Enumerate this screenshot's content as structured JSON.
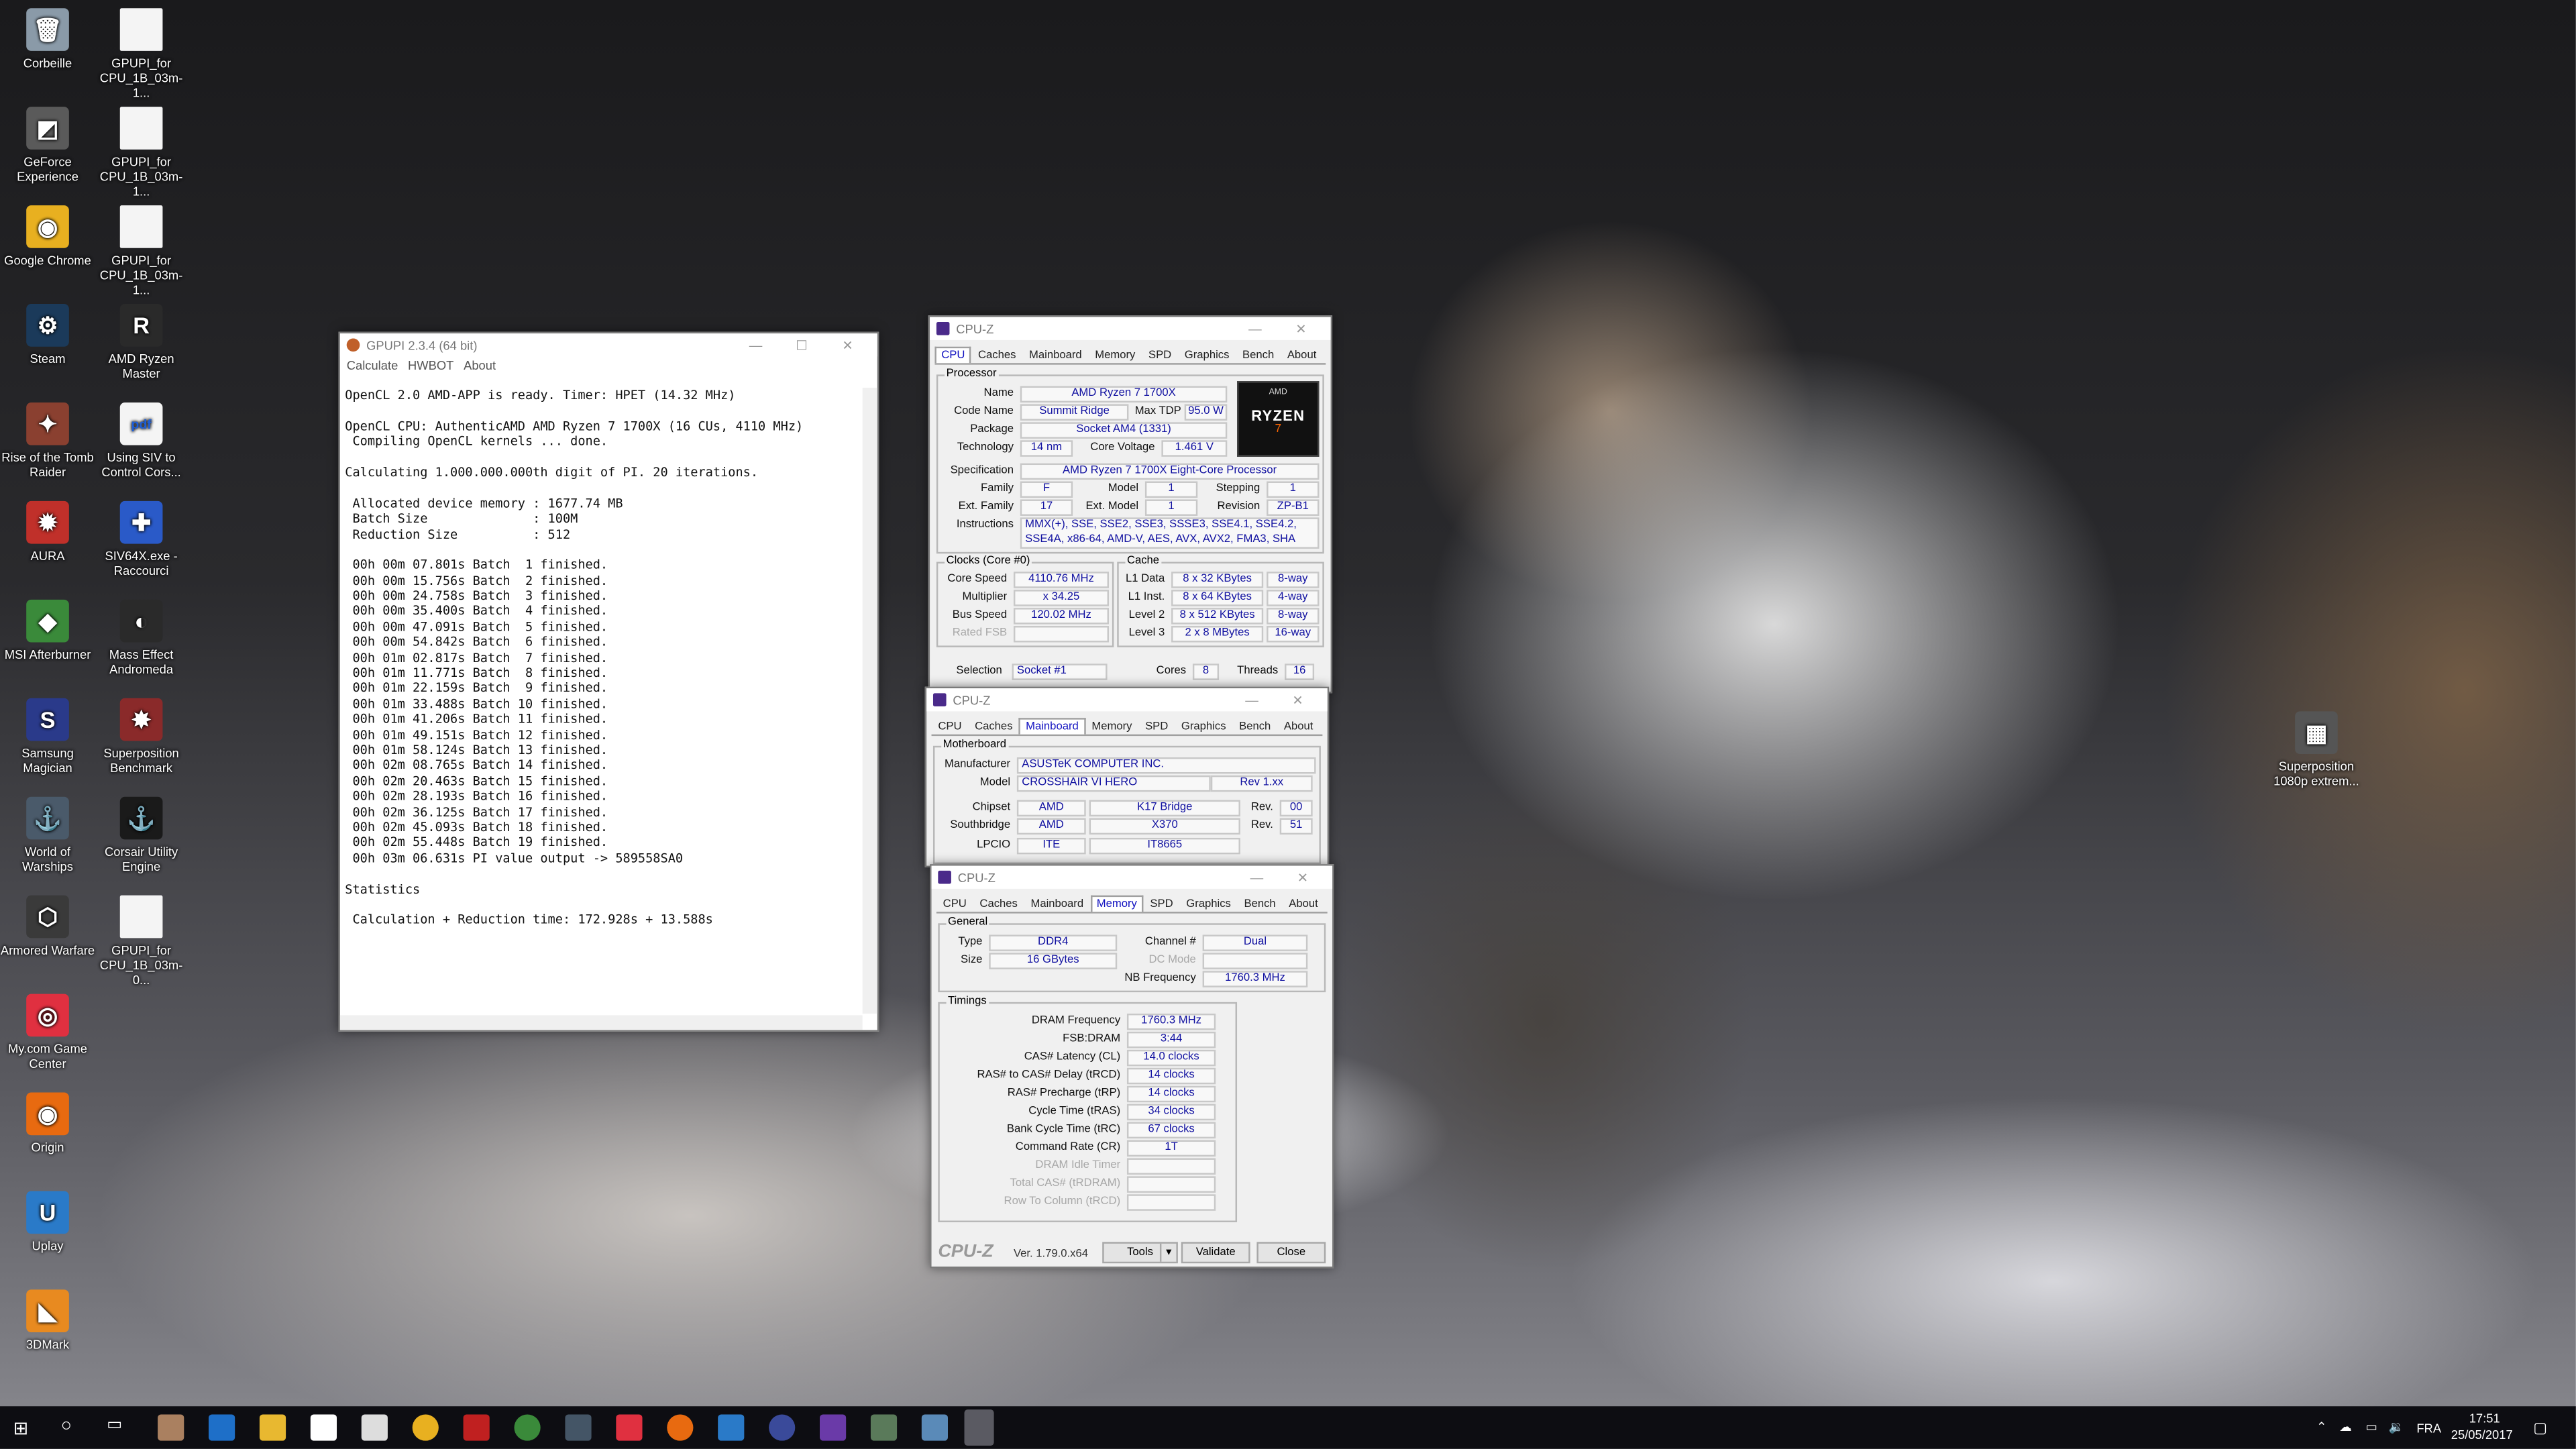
{
  "desktop": {
    "icons": [
      {
        "label": "Corbeille",
        "icon": "recycle-bin-icon",
        "color": "#8a9aa8",
        "glyph": "🗑"
      },
      {
        "label": "GeForce Experience",
        "icon": "geforce-icon",
        "color": "#5a5a5a",
        "glyph": "◩"
      },
      {
        "label": "Google Chrome",
        "icon": "chrome-icon",
        "color": "#e8b020",
        "glyph": "◉"
      },
      {
        "label": "Steam",
        "icon": "steam-icon",
        "color": "#1b3a5a",
        "glyph": "⚙"
      },
      {
        "label": "Rise of the Tomb Raider",
        "icon": "tomb-raider-icon",
        "color": "#8a4030",
        "glyph": "✦"
      },
      {
        "label": "AURA",
        "icon": "aura-icon",
        "color": "#c0302a",
        "glyph": "✹"
      },
      {
        "label": "MSI Afterburner",
        "icon": "msi-afterburner-icon",
        "color": "#3a8a3a",
        "glyph": "◆"
      },
      {
        "label": "Samsung Magician",
        "icon": "samsung-magician-icon",
        "color": "#2a3a8a",
        "glyph": "S"
      },
      {
        "label": "World of Warships",
        "icon": "world-of-warships-icon",
        "color": "#4a5a6a",
        "glyph": "⚓"
      },
      {
        "label": "Armored Warfare",
        "icon": "armored-warfare-icon",
        "color": "#3a3a3a",
        "glyph": "⬡"
      },
      {
        "label": "My.com Game Center",
        "icon": "game-center-icon",
        "color": "#e03040",
        "glyph": "◎"
      },
      {
        "label": "Origin",
        "icon": "origin-icon",
        "color": "#e86a10",
        "glyph": "◉"
      },
      {
        "label": "Uplay",
        "icon": "uplay-icon",
        "color": "#2a7ac8",
        "glyph": "U"
      },
      {
        "label": "3DMark",
        "icon": "3dmark-icon",
        "color": "#e88a20",
        "glyph": "◣"
      }
    ],
    "icons_col2": [
      {
        "label": "GPUPI_for CPU_1B_03m-1...",
        "icon": "document-icon"
      },
      {
        "label": "GPUPI_for CPU_1B_03m-1...",
        "icon": "document-icon"
      },
      {
        "label": "GPUPI_for CPU_1B_03m-1...",
        "icon": "document-icon"
      },
      {
        "label": "AMD Ryzen Master",
        "icon": "ryzen-master-icon",
        "color": "#2a2a2a",
        "glyph": "R"
      },
      {
        "label": "Using SIV to Control Cors...",
        "icon": "pdf-icon",
        "color": "#f4f4f4",
        "glyph": "pdf"
      },
      {
        "label": "SIV64X.exe - Raccourci",
        "icon": "siv-icon",
        "color": "#2a5ac8",
        "glyph": "✚"
      },
      {
        "label": "Mass Effect Andromeda",
        "icon": "mass-effect-icon",
        "color": "#2a2a2a",
        "glyph": "◐"
      },
      {
        "label": "Superposition Benchmark",
        "icon": "superposition-icon",
        "color": "#8a2a2a",
        "glyph": "✸"
      },
      {
        "label": "Corsair Utility Engine",
        "icon": "corsair-icon",
        "color": "#1a1a1a",
        "glyph": "⚓"
      },
      {
        "label": "GPUPI_for CPU_1B_03m-0...",
        "icon": "document-icon"
      }
    ],
    "right_icon": {
      "label": "Superposition 1080p extrem...",
      "icon": "superposition-shortcut-icon"
    }
  },
  "gpupi": {
    "title": "GPUPI 2.3.4 (64 bit)",
    "menu": [
      "Calculate",
      "HWBOT",
      "About"
    ],
    "log": [
      "OpenCL 2.0 AMD-APP is ready. Timer: HPET (14.32 MHz)",
      "",
      "OpenCL CPU: AuthenticAMD AMD Ryzen 7 1700X (16 CUs, 4110 MHz)",
      " Compiling OpenCL kernels ... done.",
      "",
      "Calculating 1.000.000.000th digit of PI. 20 iterations.",
      "",
      " Allocated device memory : 1677.74 MB",
      " Batch Size              : 100M",
      " Reduction Size          : 512",
      "",
      " 00h 00m 07.801s Batch  1 finished.",
      " 00h 00m 15.756s Batch  2 finished.",
      " 00h 00m 24.758s Batch  3 finished.",
      " 00h 00m 35.400s Batch  4 finished.",
      " 00h 00m 47.091s Batch  5 finished.",
      " 00h 00m 54.842s Batch  6 finished.",
      " 00h 01m 02.817s Batch  7 finished.",
      " 00h 01m 11.771s Batch  8 finished.",
      " 00h 01m 22.159s Batch  9 finished.",
      " 00h 01m 33.488s Batch 10 finished.",
      " 00h 01m 41.206s Batch 11 finished.",
      " 00h 01m 49.151s Batch 12 finished.",
      " 00h 01m 58.124s Batch 13 finished.",
      " 00h 02m 08.765s Batch 14 finished.",
      " 00h 02m 20.463s Batch 15 finished.",
      " 00h 02m 28.193s Batch 16 finished.",
      " 00h 02m 36.125s Batch 17 finished.",
      " 00h 02m 45.093s Batch 18 finished.",
      " 00h 02m 55.448s Batch 19 finished.",
      " 00h 03m 06.631s PI value output -> 589558SA0",
      "",
      "Statistics",
      "",
      " Calculation + Reduction time: 172.928s + 13.588s"
    ]
  },
  "cpuz_common": {
    "title": "CPU-Z",
    "tabs": [
      "CPU",
      "Caches",
      "Mainboard",
      "Memory",
      "SPD",
      "Graphics",
      "Bench",
      "About"
    ]
  },
  "cpuz_cpu": {
    "processor_legend": "Processor",
    "name_label": "Name",
    "name": "AMD Ryzen 7 1700X",
    "codename_label": "Code Name",
    "codename": "Summit Ridge",
    "maxtdp_label": "Max TDP",
    "maxtdp": "95.0 W",
    "package_label": "Package",
    "package": "Socket AM4 (1331)",
    "tech_label": "Technology",
    "tech": "14 nm",
    "voltage_label": "Core Voltage",
    "voltage": "1.461 V",
    "spec_label": "Specification",
    "spec": "AMD Ryzen 7 1700X Eight-Core Processor",
    "family_label": "Family",
    "family": "F",
    "model_label": "Model",
    "model": "1",
    "stepping_label": "Stepping",
    "stepping": "1",
    "extfamily_label": "Ext. Family",
    "extfamily": "17",
    "extmodel_label": "Ext. Model",
    "extmodel": "1",
    "revision_label": "Revision",
    "revision": "ZP-B1",
    "instr_label": "Instructions",
    "instr": "MMX(+), SSE, SSE2, SSE3, SSSE3, SSE4.1, SSE4.2, SSE4A, x86-64, AMD-V, AES, AVX, AVX2, FMA3, SHA",
    "logo_top": "AMD",
    "logo_text": "RYZEN",
    "logo_num": "7",
    "clocks_legend": "Clocks (Core #0)",
    "corespeed_label": "Core Speed",
    "corespeed": "4110.76 MHz",
    "mult_label": "Multiplier",
    "mult": "x 34.25",
    "bus_label": "Bus Speed",
    "bus": "120.02 MHz",
    "fsb_label": "Rated FSB",
    "fsb": "",
    "cache_legend": "Cache",
    "l1d_label": "L1 Data",
    "l1d": "8 x 32 KBytes",
    "l1d_way": "8-way",
    "l1i_label": "L1 Inst.",
    "l1i": "8 x 64 KBytes",
    "l1i_way": "4-way",
    "l2_label": "Level 2",
    "l2": "8 x 512 KBytes",
    "l2_way": "8-way",
    "l3_label": "Level 3",
    "l3": "2 x 8 MBytes",
    "l3_way": "16-way",
    "selection_label": "Selection",
    "selection": "Socket #1",
    "cores_label": "Cores",
    "cores": "8",
    "threads_label": "Threads",
    "threads": "16"
  },
  "cpuz_mb": {
    "legend": "Motherboard",
    "manuf_label": "Manufacturer",
    "manuf": "ASUSTeK COMPUTER INC.",
    "model_label": "Model",
    "model": "CROSSHAIR VI HERO",
    "model_rev": "Rev 1.xx",
    "chipset_label": "Chipset",
    "chipset_v": "AMD",
    "chipset": "K17 Bridge",
    "rev_label": "Rev.",
    "chipset_rev": "00",
    "south_label": "Southbridge",
    "south_v": "AMD",
    "south": "X370",
    "south_rev": "51",
    "lpcio_label": "LPCIO",
    "lpcio_v": "ITE",
    "lpcio": "IT8665"
  },
  "cpuz_mem": {
    "general_legend": "General",
    "type_label": "Type",
    "type": "DDR4",
    "size_label": "Size",
    "size": "16 GBytes",
    "channel_label": "Channel #",
    "channel": "Dual",
    "dcmode_label": "DC Mode",
    "dcmode": "",
    "nbfreq_label": "NB Frequency",
    "nbfreq": "1760.3 MHz",
    "timings_legend": "Timings",
    "timings": [
      {
        "label": "DRAM Frequency",
        "value": "1760.3 MHz",
        "grey": false
      },
      {
        "label": "FSB:DRAM",
        "value": "3:44",
        "grey": false
      },
      {
        "label": "CAS# Latency (CL)",
        "value": "14.0 clocks",
        "grey": false
      },
      {
        "label": "RAS# to CAS# Delay (tRCD)",
        "value": "14 clocks",
        "grey": false
      },
      {
        "label": "RAS# Precharge (tRP)",
        "value": "14 clocks",
        "grey": false
      },
      {
        "label": "Cycle Time (tRAS)",
        "value": "34 clocks",
        "grey": false
      },
      {
        "label": "Bank Cycle Time (tRC)",
        "value": "67 clocks",
        "grey": false
      },
      {
        "label": "Command Rate (CR)",
        "value": "1T",
        "grey": false
      },
      {
        "label": "DRAM Idle Timer",
        "value": "",
        "grey": true
      },
      {
        "label": "Total CAS# (tRDRAM)",
        "value": "",
        "grey": true
      },
      {
        "label": "Row To Column (tRCD)",
        "value": "",
        "grey": true
      }
    ],
    "brand": "CPU-Z",
    "version": "Ver. 1.79.0.x64",
    "tools_label": "Tools",
    "validate_label": "Validate",
    "close_label": "Close"
  },
  "taskbar": {
    "lang": "FRA",
    "time": "17:51",
    "date": "25/05/2017"
  }
}
